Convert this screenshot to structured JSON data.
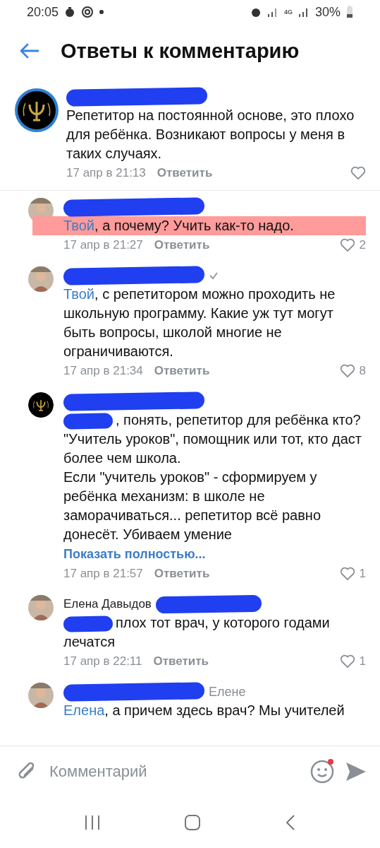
{
  "status_bar": {
    "time": "20:05",
    "network": "4G",
    "battery": "30%"
  },
  "header": {
    "title": "Ответы к комментарию"
  },
  "comments": [
    {
      "kind": "root",
      "avatar_logo": true,
      "name_redacted": true,
      "verified": false,
      "body": {
        "prefix_redacted": false,
        "text": "Репетитор на постоянной основе, это плохо для ребёнка. Возникают вопросы у меня в таких случаях."
      },
      "date": "17 апр в 21:13",
      "reply": "Ответить",
      "highlighted": false
    },
    {
      "kind": "reply",
      "avatar_logo": false,
      "name_redacted": true,
      "verified": false,
      "body": {
        "prefix_redacted": false,
        "mention": "Твой",
        "text": ", а почему? Учить как-то надо."
      },
      "date": "17 апр в 21:27",
      "reply": "Ответить",
      "likes": "2",
      "highlighted": true
    },
    {
      "kind": "reply",
      "avatar_logo": false,
      "name_redacted": true,
      "verified": true,
      "body": {
        "prefix_redacted": false,
        "mention": "Твой",
        "text": ", с репетитором можно проходить не школьную программу. Какие уж тут могут быть вопросы, школой многие не ограничиваются."
      },
      "date": "17 апр в 21:34",
      "reply": "Ответить",
      "likes": "8",
      "highlighted": false
    },
    {
      "kind": "reply",
      "avatar_logo": true,
      "name_redacted": true,
      "verified": false,
      "body": {
        "prefix_redacted": true,
        "text": ", понять, репетитор для ребёнка кто? \"Учитель уроков\", помощник или тот, кто даст более чем школа.\nЕсли \"учитель уроков\" - сформируем у ребёнка механизм: в школе не заморачиваться... репетитор всё равно донесёт. Убиваем умение"
      },
      "show_more": "Показать полностью...",
      "date": "17 апр в 21:57",
      "reply": "Ответить",
      "likes": "1",
      "highlighted": false
    },
    {
      "kind": "reply",
      "avatar_logo": false,
      "name": "Елена Давыдов",
      "name_redacted": true,
      "verified": false,
      "body": {
        "prefix_redacted": true,
        "text": "плох тот врач, у которого годами лечатся"
      },
      "date": "17 апр в 22:11",
      "reply": "Ответить",
      "likes": "1",
      "highlighted": false
    },
    {
      "kind": "reply",
      "avatar_logo": false,
      "name_redacted": true,
      "verified": false,
      "reply_to": "Елене",
      "body": {
        "prefix_redacted": false,
        "mention": "Елена",
        "text": ", а причем здесь врач? Мы учителей"
      },
      "highlighted": false
    }
  ],
  "composer": {
    "placeholder": "Комментарий",
    "emoji_badge": true
  }
}
